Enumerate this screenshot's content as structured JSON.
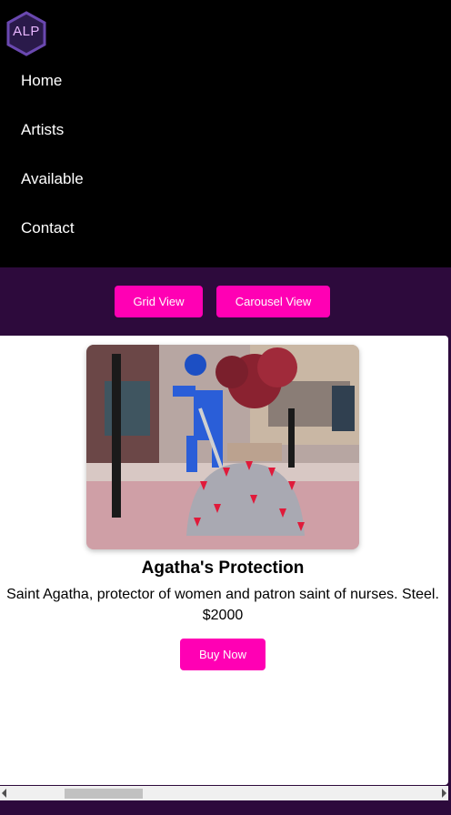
{
  "logo": {
    "text": "ALP",
    "icon": "hexagon-logo-icon"
  },
  "nav": {
    "links": [
      "Home",
      "Artists",
      "Available",
      "Contact"
    ]
  },
  "view_toggle": {
    "grid_label": "Grid View",
    "carousel_label": "Carousel View"
  },
  "artwork": {
    "title": "Agatha's Protection",
    "description": "Saint Agatha, protector of women and patron saint of nurses. Steel.",
    "price": "$2000",
    "buy_label": "Buy Now",
    "image": "sculpture-photo"
  },
  "colors": {
    "accent": "#ff00b4",
    "page_bg": "#2d0a3c",
    "nav_bg": "#000000",
    "logo_hex": "#5a3a9a"
  }
}
